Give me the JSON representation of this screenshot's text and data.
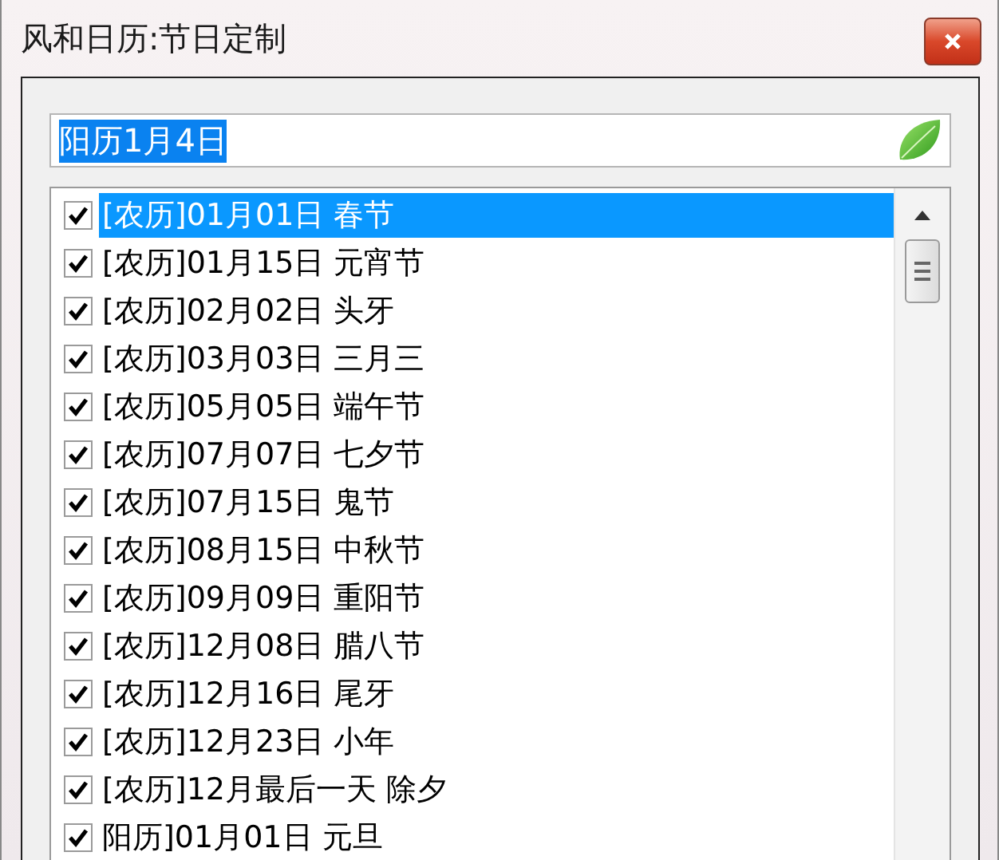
{
  "window": {
    "title": "风和日历:节日定制"
  },
  "date_field": {
    "value": "阳历1月4日",
    "value_selected": true
  },
  "festivals": [
    {
      "label": "[农历]01月01日 春节",
      "checked": true,
      "selected": true
    },
    {
      "label": "[农历]01月15日 元宵节",
      "checked": true,
      "selected": false
    },
    {
      "label": "[农历]02月02日 头牙",
      "checked": true,
      "selected": false
    },
    {
      "label": "[农历]03月03日 三月三",
      "checked": true,
      "selected": false
    },
    {
      "label": "[农历]05月05日 端午节",
      "checked": true,
      "selected": false
    },
    {
      "label": "[农历]07月07日 七夕节",
      "checked": true,
      "selected": false
    },
    {
      "label": "[农历]07月15日 鬼节",
      "checked": true,
      "selected": false
    },
    {
      "label": "[农历]08月15日 中秋节",
      "checked": true,
      "selected": false
    },
    {
      "label": "[农历]09月09日 重阳节",
      "checked": true,
      "selected": false
    },
    {
      "label": "[农历]12月08日 腊八节",
      "checked": true,
      "selected": false
    },
    {
      "label": "[农历]12月16日 尾牙",
      "checked": true,
      "selected": false
    },
    {
      "label": "[农历]12月23日 小年",
      "checked": true,
      "selected": false
    },
    {
      "label": "[农历]12月最后一天 除夕",
      "checked": true,
      "selected": false
    },
    {
      "label": "阳历]01月01日 元旦",
      "checked": true,
      "selected": false
    }
  ]
}
